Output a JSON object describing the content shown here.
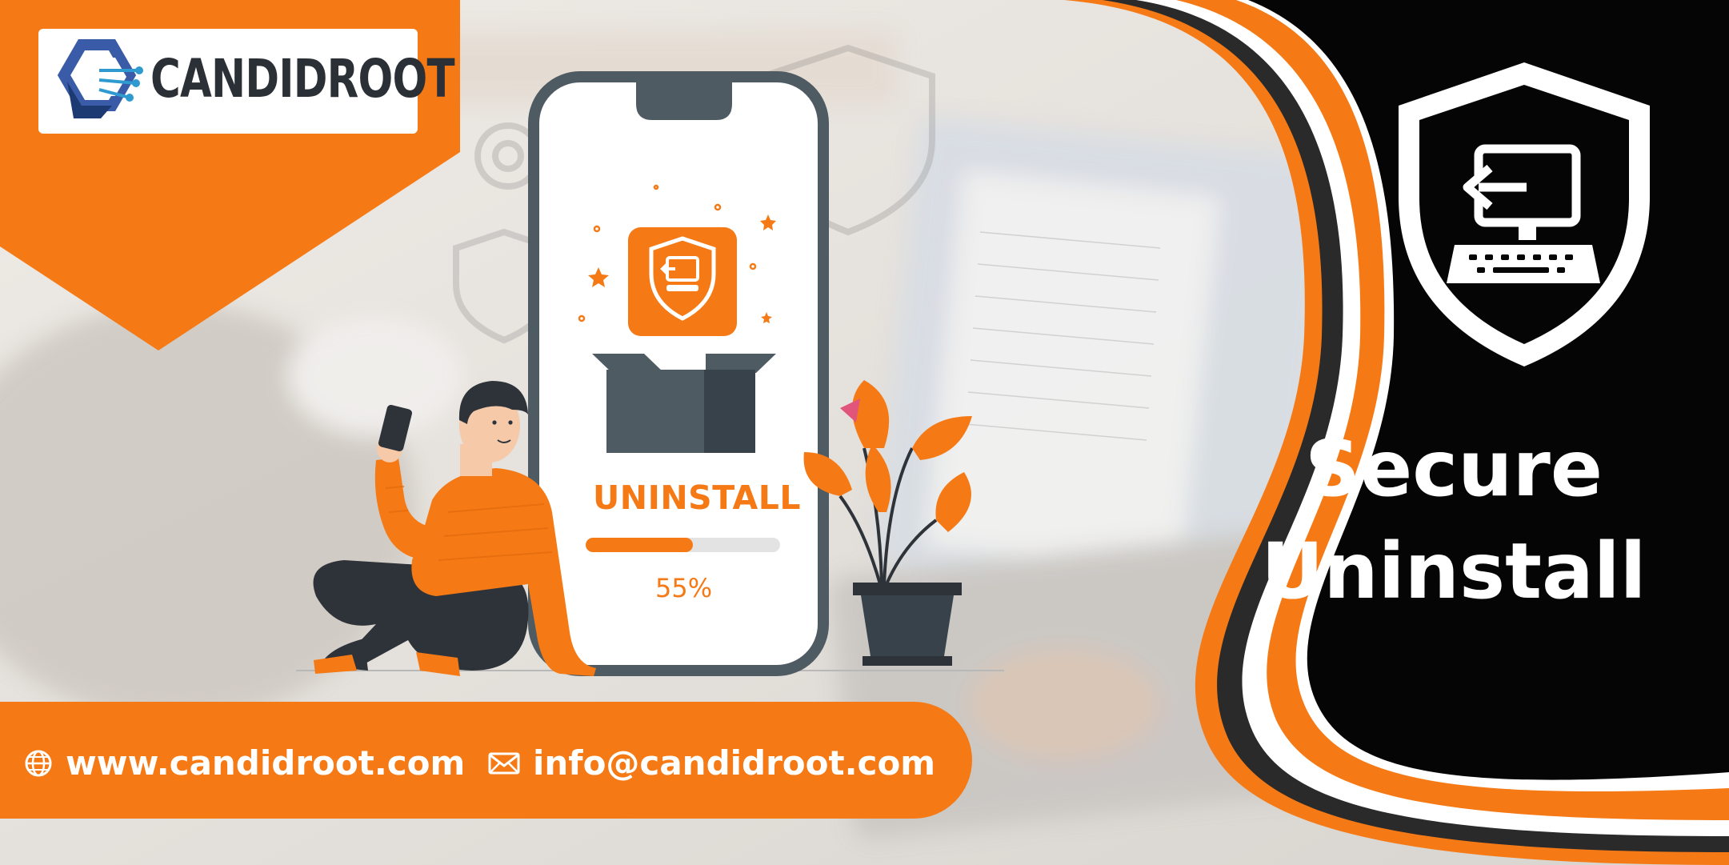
{
  "brand": {
    "name": "CANDIDROOT",
    "logo_icon": "hexagon-circuit-icon"
  },
  "phone_screen": {
    "app_icon": "shield-computer-icon",
    "box_icon": "open-box-icon",
    "label": "UNINSTALL",
    "progress_percent": 55,
    "progress_label": "55%"
  },
  "headline": {
    "line1": "Secure",
    "line2": "Uninstall",
    "icon": "shield-computer-icon"
  },
  "footer": {
    "website": "www.candidroot.com",
    "website_icon": "globe-icon",
    "email": "info@candidroot.com",
    "email_icon": "mail-icon"
  },
  "colors": {
    "accent": "#f57a16",
    "dark": "#050505",
    "text_dark": "#2b2f36",
    "white": "#ffffff"
  }
}
